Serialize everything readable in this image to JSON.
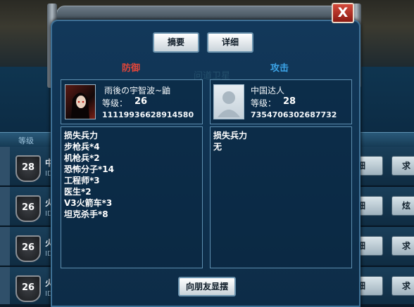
{
  "background": {
    "header_level_label": "等级",
    "rows": [
      {
        "level": "28",
        "title": "中",
        "id": "ID",
        "detail_btn": "细",
        "extra_btn": "求"
      },
      {
        "level": "26",
        "title": "火",
        "id": "ID",
        "detail_btn": "细",
        "extra_btn": "炫"
      },
      {
        "level": "26",
        "title": "火",
        "id": "ID",
        "detail_btn": "细",
        "extra_btn": "求"
      },
      {
        "level": "26",
        "title": "火",
        "id": "ID",
        "detail_btn": "细",
        "extra_btn": "求"
      }
    ]
  },
  "dialog": {
    "close_label": "X",
    "tabs": {
      "summary": "摘要",
      "detail": "详细"
    },
    "ghost_title": "问道卫星",
    "defense": {
      "side_label": "防御",
      "name": "雨後の宇智波~鼬",
      "level_label": "等级：",
      "level": "26",
      "player_id": "11119936628914580",
      "loss_title": "损失兵力",
      "losses": [
        "步枪兵*4",
        "机枪兵*2",
        "恐怖分子*14",
        "工程师*3",
        "医生*2",
        "V3火箭车*3",
        "坦克杀手*8"
      ]
    },
    "attack": {
      "side_label": "攻击",
      "name": "中国达人",
      "level_label": "等级：",
      "level": "28",
      "player_id": "7354706302687732",
      "loss_title": "损失兵力",
      "losses": [
        "无"
      ]
    },
    "share_button": "向朋友显摆"
  },
  "colors": {
    "defense": "#e0463a",
    "attack": "#3ba3e6",
    "panel_border": "#5e8fb0"
  }
}
